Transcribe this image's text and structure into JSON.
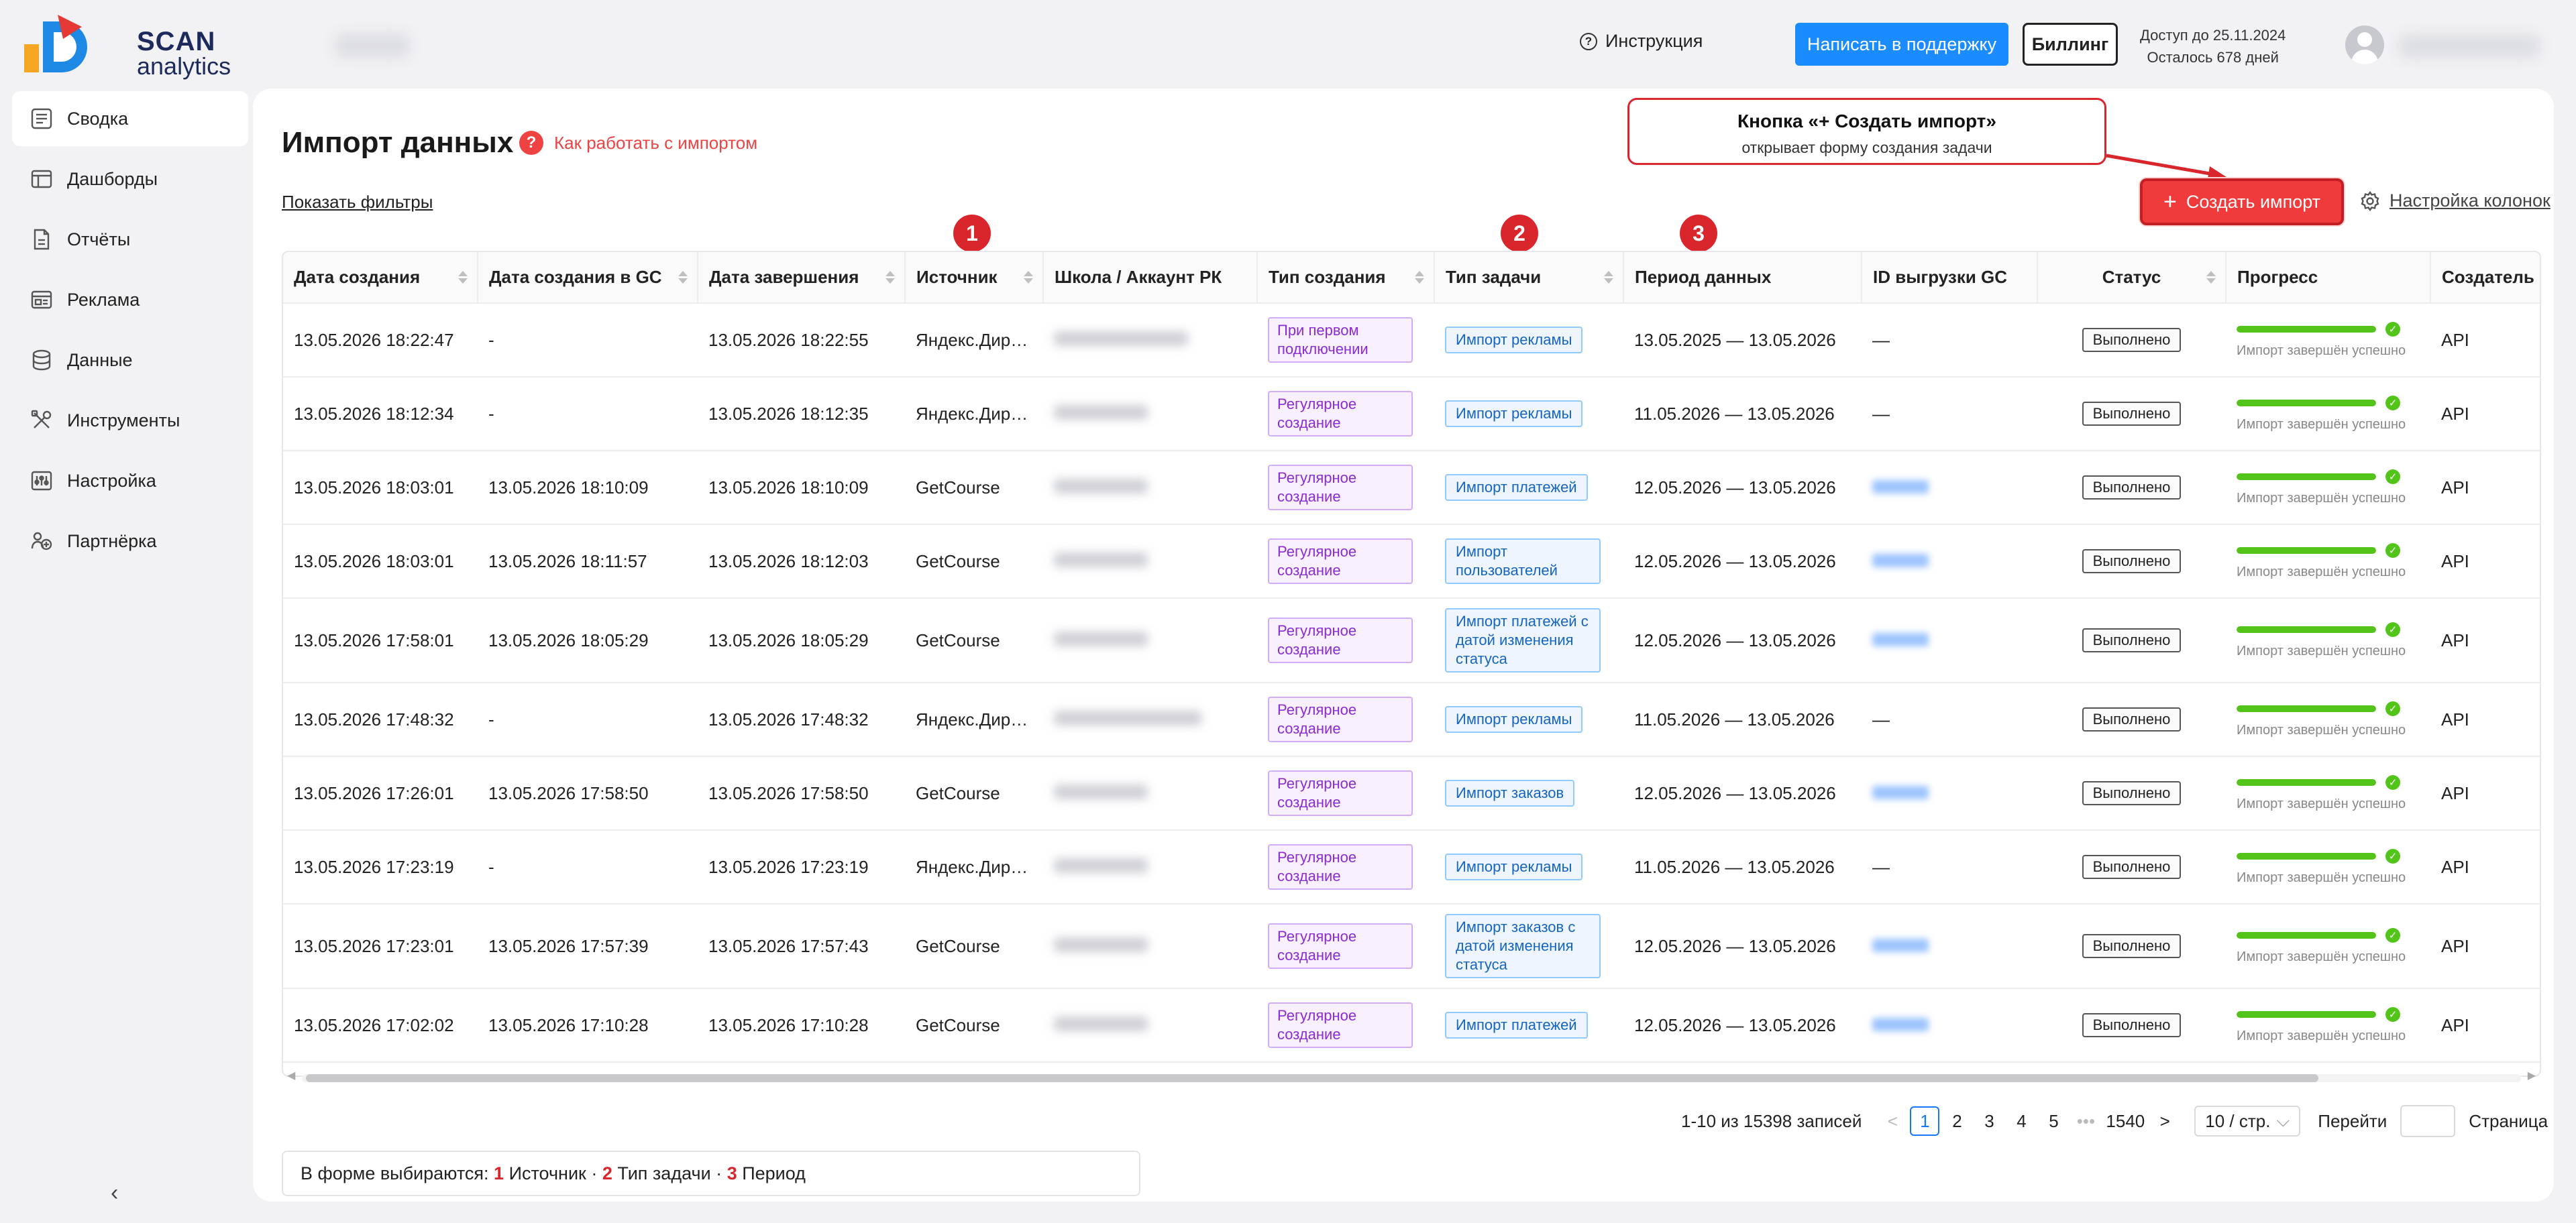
{
  "brand": {
    "line1": "SCAN",
    "line2": "analytics"
  },
  "header": {
    "instruction": "Инструкция",
    "support_button": "Написать в поддержку",
    "billing_button": "Биллинг",
    "access_line1": "Доступ до 25.11.2024",
    "access_line2": "Осталось 678 дней"
  },
  "sidebar": {
    "items": [
      {
        "label": "Сводка",
        "icon": "summary-icon"
      },
      {
        "label": "Дашборды",
        "icon": "dashboard-icon"
      },
      {
        "label": "Отчёты",
        "icon": "report-icon"
      },
      {
        "label": "Реклама",
        "icon": "ads-icon"
      },
      {
        "label": "Данные",
        "icon": "database-icon"
      },
      {
        "label": "Инструменты",
        "icon": "tools-icon"
      },
      {
        "label": "Настройка",
        "icon": "settings-icon"
      },
      {
        "label": "Партнёрка",
        "icon": "partners-icon"
      }
    ],
    "collapse_icon": "chevron-left-icon",
    "collapse_glyph": "‹"
  },
  "page": {
    "title": "Импорт данных",
    "howto_icon": "?",
    "howto": "Как работать с импортом",
    "show_filters": "Показать фильтры",
    "callout_title": "Кнопка «+ Создать импорт»",
    "callout_sub": "открывает форму создания задачи",
    "create_plus": "+",
    "create_button": "Создать импорт",
    "column_settings": "Настройка колонок",
    "badges": [
      "1",
      "2",
      "3"
    ]
  },
  "table": {
    "columns": [
      "Дата создания",
      "Дата создания в GC",
      "Дата завершения",
      "Источник",
      "Школа / Аккаунт РК",
      "Тип создания",
      "Тип задачи",
      "Период данных",
      "ID выгрузки GC",
      "Статус",
      "Прогресс",
      "Создатель"
    ],
    "progress_note": "Импорт завершён успешно",
    "progress_check": "✓",
    "progress_value": 1.0,
    "rows": [
      {
        "created": "13.05.2026 18:22:47",
        "created_gc": "-",
        "finished": "13.05.2026 18:22:55",
        "source": "Яндекс.Директ",
        "account": "",
        "create_type": "При первом подключении",
        "task_type": "Импорт рекламы",
        "period": "13.05.2025 — 13.05.2026",
        "gc_id": "—",
        "status": "Выполнено",
        "creator": "API"
      },
      {
        "created": "13.05.2026 18:12:34",
        "created_gc": "-",
        "finished": "13.05.2026 18:12:35",
        "source": "Яндекс.Директ",
        "account": "",
        "create_type": "Регулярное создание",
        "task_type": "Импорт рекламы",
        "period": "11.05.2026 — 13.05.2026",
        "gc_id": "—",
        "status": "Выполнено",
        "creator": "API"
      },
      {
        "created": "13.05.2026 18:03:01",
        "created_gc": "13.05.2026 18:10:09",
        "finished": "13.05.2026 18:10:09",
        "source": "GetCourse",
        "account": "",
        "create_type": "Регулярное создание",
        "task_type": "Импорт платежей",
        "period": "12.05.2026 — 13.05.2026",
        "gc_id": "",
        "status": "Выполнено",
        "creator": "API"
      },
      {
        "created": "13.05.2026 18:03:01",
        "created_gc": "13.05.2026 18:11:57",
        "finished": "13.05.2026 18:12:03",
        "source": "GetCourse",
        "account": "",
        "create_type": "Регулярное создание",
        "task_type": "Импорт пользователей",
        "period": "12.05.2026 — 13.05.2026",
        "gc_id": "",
        "status": "Выполнено",
        "creator": "API"
      },
      {
        "created": "13.05.2026 17:58:01",
        "created_gc": "13.05.2026 18:05:29",
        "finished": "13.05.2026 18:05:29",
        "source": "GetCourse",
        "account": "",
        "create_type": "Регулярное создание",
        "task_type": "Импорт платежей с датой изменения статуса",
        "period": "12.05.2026 — 13.05.2026",
        "gc_id": "",
        "status": "Выполнено",
        "creator": "API"
      },
      {
        "created": "13.05.2026 17:48:32",
        "created_gc": "-",
        "finished": "13.05.2026 17:48:32",
        "source": "Яндекс.Директ",
        "account": "",
        "create_type": "Регулярное создание",
        "task_type": "Импорт рекламы",
        "period": "11.05.2026 — 13.05.2026",
        "gc_id": "—",
        "status": "Выполнено",
        "creator": "API"
      },
      {
        "created": "13.05.2026 17:26:01",
        "created_gc": "13.05.2026 17:58:50",
        "finished": "13.05.2026 17:58:50",
        "source": "GetCourse",
        "account": "",
        "create_type": "Регулярное создание",
        "task_type": "Импорт заказов",
        "period": "12.05.2026 — 13.05.2026",
        "gc_id": "",
        "status": "Выполнено",
        "creator": "API"
      },
      {
        "created": "13.05.2026 17:23:19",
        "created_gc": "-",
        "finished": "13.05.2026 17:23:19",
        "source": "Яндекс.Директ",
        "account": "",
        "create_type": "Регулярное создание",
        "task_type": "Импорт рекламы",
        "period": "11.05.2026 — 13.05.2026",
        "gc_id": "—",
        "status": "Выполнено",
        "creator": "API"
      },
      {
        "created": "13.05.2026 17:23:01",
        "created_gc": "13.05.2026 17:57:39",
        "finished": "13.05.2026 17:57:43",
        "source": "GetCourse",
        "account": "",
        "create_type": "Регулярное создание",
        "task_type": "Импорт заказов с датой изменения статуса",
        "period": "12.05.2026 — 13.05.2026",
        "gc_id": "",
        "status": "Выполнено",
        "creator": "API"
      },
      {
        "created": "13.05.2026 17:02:02",
        "created_gc": "13.05.2026 17:10:28",
        "finished": "13.05.2026 17:10:28",
        "source": "GetCourse",
        "account": "",
        "create_type": "Регулярное создание",
        "task_type": "Импорт платежей",
        "period": "12.05.2026 — 13.05.2026",
        "gc_id": "",
        "status": "Выполнено",
        "creator": "API"
      }
    ]
  },
  "pagination": {
    "summary": "1-10 из 15398 записей",
    "prev": "<",
    "pages": [
      "1",
      "2",
      "3",
      "4",
      "5"
    ],
    "ellipsis": "•••",
    "last": "1540",
    "next": ">",
    "page_size": "10 / стр.",
    "page_size_caret": "⌵",
    "goto_label": "Перейти",
    "page_label": "Страница"
  },
  "legend": {
    "prefix": "В форме выбираются:",
    "n1": "1",
    "t1": "Источник",
    "sep1": "·",
    "n2": "2",
    "t2": "Тип задачи",
    "sep2": "·",
    "n3": "3",
    "t3": "Период"
  },
  "colors": {
    "accent_red": "#ef3b3b",
    "primary_blue": "#1a8cff",
    "success_green": "#52c41a"
  }
}
